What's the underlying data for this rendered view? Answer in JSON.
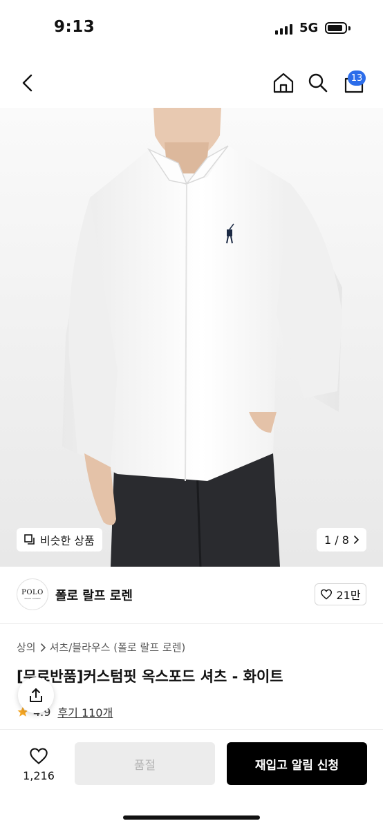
{
  "status_bar": {
    "time": "9:13",
    "network": "5G"
  },
  "nav": {
    "cart_count": "13"
  },
  "hero": {
    "similar_label": "비슷한 상품",
    "page_indicator": "1 / 8"
  },
  "brand": {
    "logo_text": "POLO",
    "logo_subtext": "RALPH LAUREN",
    "name": "폴로 랄프 로렌",
    "like_count": "21만"
  },
  "product": {
    "breadcrumb": [
      "상의",
      "셔츠/블라우스 (폴로 랄프 로렌)"
    ],
    "title": "[무료반품]커스텀핏 옥스포드 셔츠 - 화이트",
    "rating_value": "4.9",
    "review_label": "후기 110개"
  },
  "bottom_bar": {
    "wish_count": "1,216",
    "soldout_label": "품절",
    "restock_label": "재입고 알림 신청"
  },
  "colors": {
    "accent_badge": "#2c6dea",
    "primary_button": "#000000",
    "disabled_button": "#ececec",
    "star": "#f5a623"
  },
  "icons": [
    "back-chevron-icon",
    "home-icon",
    "search-icon",
    "cart-icon",
    "similar-icon",
    "chevron-right-icon",
    "heart-icon",
    "share-icon",
    "star-icon"
  ]
}
